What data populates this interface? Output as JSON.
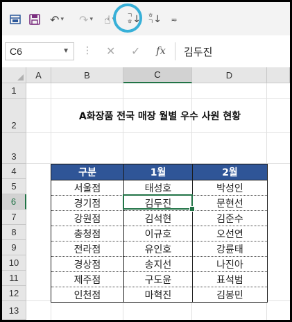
{
  "toolbar": {
    "items": [
      "save-layout-icon",
      "save-icon",
      "undo-icon",
      "redo-icon",
      "touch-mode-icon",
      "sort-ascending-icon",
      "sort-descending-icon",
      "customize-icon"
    ]
  },
  "formula_bar": {
    "name_box": "C6",
    "fx_label": "fx",
    "value": "김두진"
  },
  "columns": [
    "A",
    "B",
    "C",
    "D"
  ],
  "rows": [
    "1",
    "2",
    "3",
    "4",
    "5",
    "6",
    "7",
    "8",
    "9",
    "10",
    "11",
    "12",
    "13"
  ],
  "sheet": {
    "title": "A화장품 전국 매장 월별 우수 사원 현황",
    "headers": [
      "구분",
      "1월",
      "2월"
    ],
    "data": [
      [
        "서울점",
        "태성호",
        "박성인"
      ],
      [
        "경기점",
        "김두진",
        "문현선"
      ],
      [
        "강원점",
        "김석현",
        "김준수"
      ],
      [
        "충청점",
        "이규호",
        "오선연"
      ],
      [
        "전라점",
        "유인호",
        "강륜태"
      ],
      [
        "경상점",
        "송지선",
        "나진아"
      ],
      [
        "제주점",
        "구도윤",
        "표석범"
      ],
      [
        "인천점",
        "마혁진",
        "김봉민"
      ]
    ]
  },
  "colors": {
    "header_fill": "#2f5597",
    "selection": "#217346",
    "highlight_ring": "#38b0d8"
  }
}
